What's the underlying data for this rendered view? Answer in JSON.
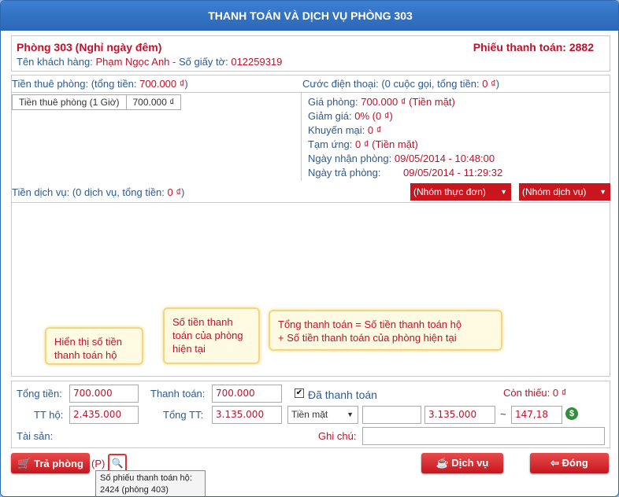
{
  "title": "THANH TOÁN VÀ DỊCH VỤ PHÒNG 303",
  "header": {
    "room": "Phòng 303 (Nghỉ ngày đêm)",
    "invoice": "Phiếu thanh toán: 2882",
    "customer_label": "Tên khách hàng: ",
    "customer_name": "Phạm Ngọc Anh",
    "id_label": " - Số giấy tờ: ",
    "id_number": "012259319"
  },
  "rent": {
    "label": "Tiền thuê phòng: (tổng tiền: ",
    "total": "700.000 ₫",
    "close": ")",
    "row_label": "Tiền thuê phòng (1 Giờ)",
    "row_value": "700.000 ₫"
  },
  "phone": {
    "label": "Cước điện thoại: (0 cuộc gọi, tổng tiền: ",
    "total": "0 ₫",
    "close": ")"
  },
  "summary": {
    "room_price_label": "Giá phòng: ",
    "room_price": "700.000 ₫ (Tiền mặt)",
    "discount_label": "Giảm giá: ",
    "discount": "0% (0 ₫)",
    "promo_label": "Khuyến mại: ",
    "promo": "0 ₫",
    "advance_label": "Tạm ứng: ",
    "advance": "0 ₫ (Tiền mặt)",
    "checkin_label": "Ngày nhận phòng: ",
    "checkin": "09/05/2014 - 10:48:00",
    "checkout_label": "Ngày trả phòng:",
    "checkout": "09/05/2014 - 11:29:32"
  },
  "services": {
    "label": "Tiền dịch vụ: (0 dịch vụ, tổng tiền: ",
    "total": "0 ₫",
    "close": ")",
    "menu_group": "(Nhóm thực đơn)",
    "service_group": "(Nhóm dịch vụ)"
  },
  "tips": {
    "tip1": "Hiển thị số tiền thanh toán hộ",
    "tip2": "Số tiền thanh toán của phòng hiện tại",
    "tip3_line1": "Tổng thanh toán = Số tiền thanh toán hộ",
    "tip3_line2": "+ Số tiền thanh toán của phòng hiện tại"
  },
  "payment": {
    "total_label": "Tổng tiền:",
    "total_value": "700.000",
    "pay_label": "Thanh toán:",
    "pay_value": "700.000",
    "paid_label": "Đã thanh toán",
    "remaining_label": "Còn thiếu: ",
    "remaining_value": "0 ₫",
    "proxy_label": "TT hộ:",
    "proxy_value": "2.435.000",
    "grand_label": "Tổng TT:",
    "grand_value": "3.135.000",
    "method": "Tiền mặt",
    "amount": "3.135.000",
    "tilde": "~",
    "usd": "147,18",
    "asset_label": "Tài sản:",
    "note_label": "Ghi chú:"
  },
  "buttons": {
    "checkout": "Trả phòng",
    "shortcut": "(P)",
    "service": "Dịch vụ",
    "close": "Đóng"
  },
  "tooltip": {
    "line1": "Số phiếu thanh toán hộ:",
    "line2": "2424 (phòng 403)"
  },
  "colors": {
    "accent": "#c0122a",
    "title_bar": "#2b67b8",
    "label_blue": "#2e5a8e"
  }
}
